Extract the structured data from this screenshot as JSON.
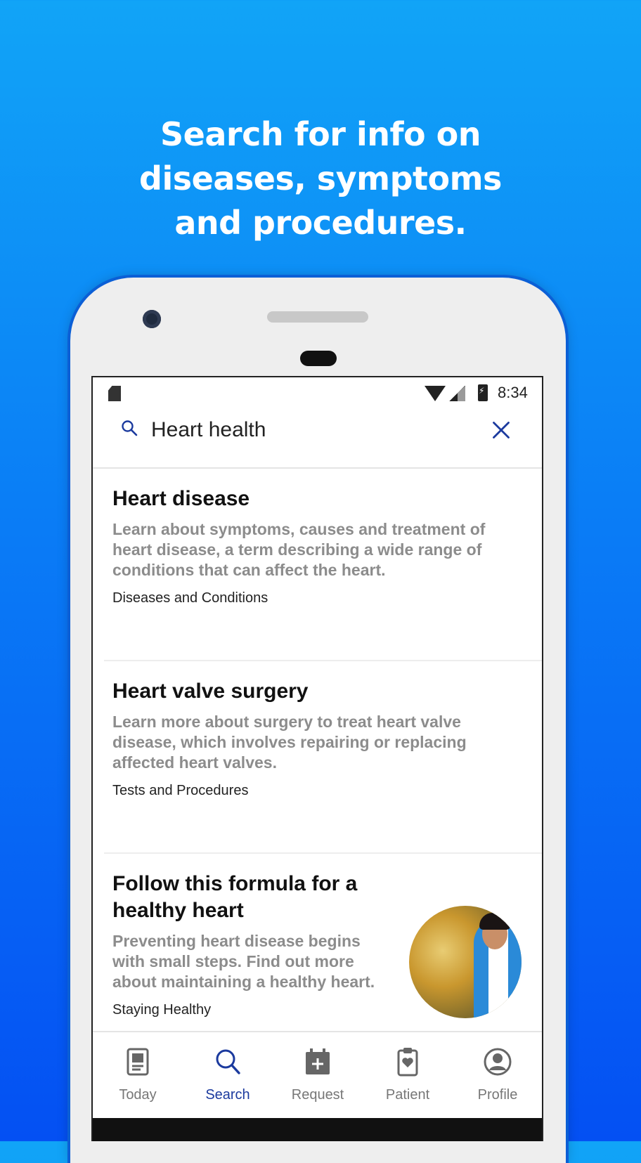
{
  "headline": {
    "line1": "Search for info on",
    "line2": "diseases, symptoms",
    "line3": "and procedures."
  },
  "status_bar": {
    "time": "8:34"
  },
  "search": {
    "value": "Heart health"
  },
  "results": [
    {
      "title": "Heart disease",
      "description": "Learn about symptoms, causes and treatment of heart disease, a term describing a wide range of conditions that can affect the heart.",
      "category": "Diseases and Conditions"
    },
    {
      "title": "Heart valve surgery",
      "description": "Learn more about surgery to treat heart valve disease, which involves repairing or replacing affected heart valves.",
      "category": "Tests and Procedures"
    },
    {
      "title": "Follow this formula for a healthy heart",
      "description": "Preventing heart disease begins with small steps. Find out more about maintaining a healthy heart.",
      "category": "Staying Healthy"
    }
  ],
  "nav": [
    {
      "label": "Today",
      "icon": "today-icon"
    },
    {
      "label": "Search",
      "icon": "search-icon",
      "active": true
    },
    {
      "label": "Request",
      "icon": "calendar-add-icon"
    },
    {
      "label": "Patient",
      "icon": "clipboard-icon"
    },
    {
      "label": "Profile",
      "icon": "profile-icon"
    }
  ],
  "colors": {
    "accent": "#1b3a9e",
    "background_top": "#11a4f7",
    "background_bottom": "#0450f3"
  }
}
